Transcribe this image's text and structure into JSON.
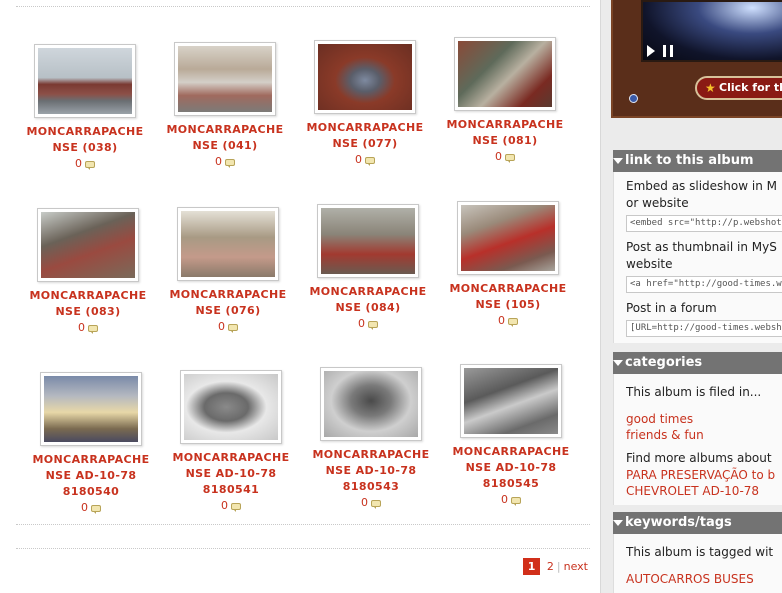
{
  "album": {
    "thumbnails": [
      {
        "title": "MONCARRAPACHE NSE (038)",
        "comments": "0",
        "image_icon": "bus-on-truck-photo"
      },
      {
        "title": "MONCARRAPACHE NSE (041)",
        "comments": "0",
        "image_icon": "bus-side-photo"
      },
      {
        "title": "MONCARRAPACHE NSE (077)",
        "comments": "0",
        "image_icon": "chevrolet-emblem-photo"
      },
      {
        "title": "MONCARRAPACHE NSE (081)",
        "comments": "0",
        "image_icon": "engine-photo"
      },
      {
        "title": "MONCARRAPACHE NSE (083)",
        "comments": "0",
        "image_icon": "driver-seat-photo"
      },
      {
        "title": "MONCARRAPACHE NSE (076)",
        "comments": "0",
        "image_icon": "bus-interior-photo"
      },
      {
        "title": "MONCARRAPACHE NSE (084)",
        "comments": "0",
        "image_icon": "bus-seats-photo"
      },
      {
        "title": "MONCARRAPACHE NSE (105)",
        "comments": "0",
        "image_icon": "bus-front-photo"
      },
      {
        "title": "MONCARRAPACHE NSE AD-10-78 8180540",
        "comments": "0",
        "image_icon": "workshop-bus-photo"
      },
      {
        "title": "MONCARRAPACHE NSE AD-10-78 8180541",
        "comments": "0",
        "image_icon": "axle-photo"
      },
      {
        "title": "MONCARRAPACHE NSE AD-10-78 8180543",
        "comments": "0",
        "image_icon": "brake-drum-photo"
      },
      {
        "title": "MONCARRAPACHE NSE AD-10-78 8180545",
        "comments": "0",
        "image_icon": "chassis-photo"
      }
    ]
  },
  "pager": {
    "current": "1",
    "page2": "2",
    "next": "next"
  },
  "video": {
    "cta": "Click for the l"
  },
  "link_panel": {
    "title": "link to this album",
    "embed_label_1": "Embed as slideshow in M",
    "embed_label_2": "or website",
    "embed_code": "<embed src=\"http://p.webshots.c",
    "thumb_label_1": "Post as thumbnail in MyS",
    "thumb_label_2": "website",
    "thumb_code": "<a href=\"http://good-times.websh",
    "forum_label": "Post in a forum",
    "forum_code": "[URL=http://good-times.webshots"
  },
  "categories_panel": {
    "title": "categories",
    "filed_in": "This album is filed in...",
    "cat1": "good times",
    "cat2": "friends & fun",
    "find_more": "Find more albums about",
    "more1": "PARA PRESERVAÇÃO to b",
    "more2": "CHEVROLET AD-10-78"
  },
  "keywords_panel": {
    "title": "keywords/tags",
    "tagged_with": "This album is tagged wit",
    "tag1": "AUTOCARROS BUSES"
  }
}
